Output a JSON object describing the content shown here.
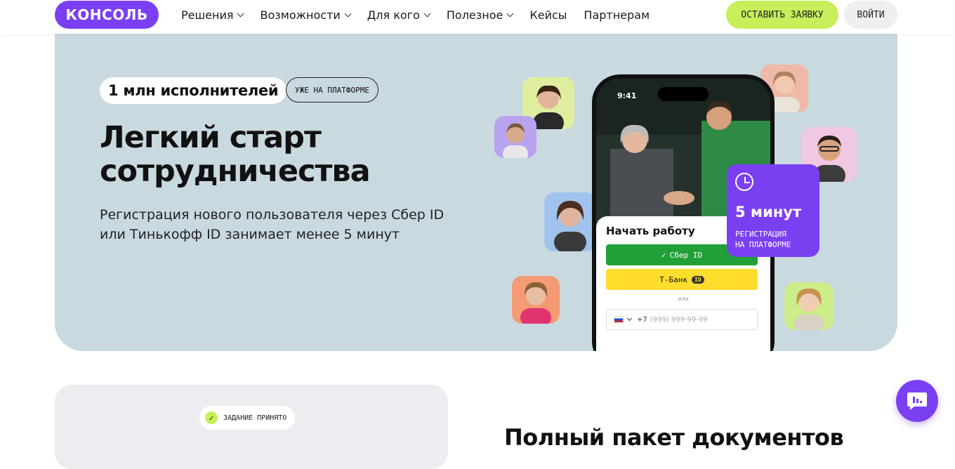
{
  "header": {
    "logo": "КОНСОЛЬ",
    "nav": [
      {
        "label": "Решения",
        "dropdown": true
      },
      {
        "label": "Возможности",
        "dropdown": true
      },
      {
        "label": "Для кого",
        "dropdown": true
      },
      {
        "label": "Полезное",
        "dropdown": true
      },
      {
        "label": "Кейсы",
        "dropdown": false
      },
      {
        "label": "Партнерам",
        "dropdown": false
      }
    ],
    "cta_label": "ОСТАВИТЬ ЗАЯВКУ",
    "login_label": "ВОЙТИ"
  },
  "hero": {
    "badge_main": "1 млн исполнителей",
    "badge_sub": "УЖЕ НА ПЛАТФОРМЕ",
    "title_line1": "Легкий старт",
    "title_line2": "сотрудничества",
    "description": "Регистрация нового пользователя через Сбер ID или Тинькофф ID занимает менее 5 минут"
  },
  "phone": {
    "time": "9:41",
    "sheet_title": "Начать работу",
    "sber_label": "Сбер ID",
    "tbank_label": "Т-Банк",
    "tbank_chip": "ID",
    "or_label": "или",
    "phone_prefix": "+7",
    "phone_placeholder": "(999) 999-99-99"
  },
  "five_card": {
    "title": "5 минут",
    "sub_line1": "РЕГИСТРАЦИЯ",
    "sub_line2": "НА ПЛАТФОРМЕ"
  },
  "section2": {
    "task_label": "ЗАДАНИЕ ПРИНЯТО",
    "docs_title": "Полный пакет документов"
  },
  "colors": {
    "brand": "#7b3ff2",
    "accent": "#c6ef5a",
    "hero_bg": "#c9d9e0",
    "sber": "#21a038",
    "tbank": "#ffdd2d"
  }
}
